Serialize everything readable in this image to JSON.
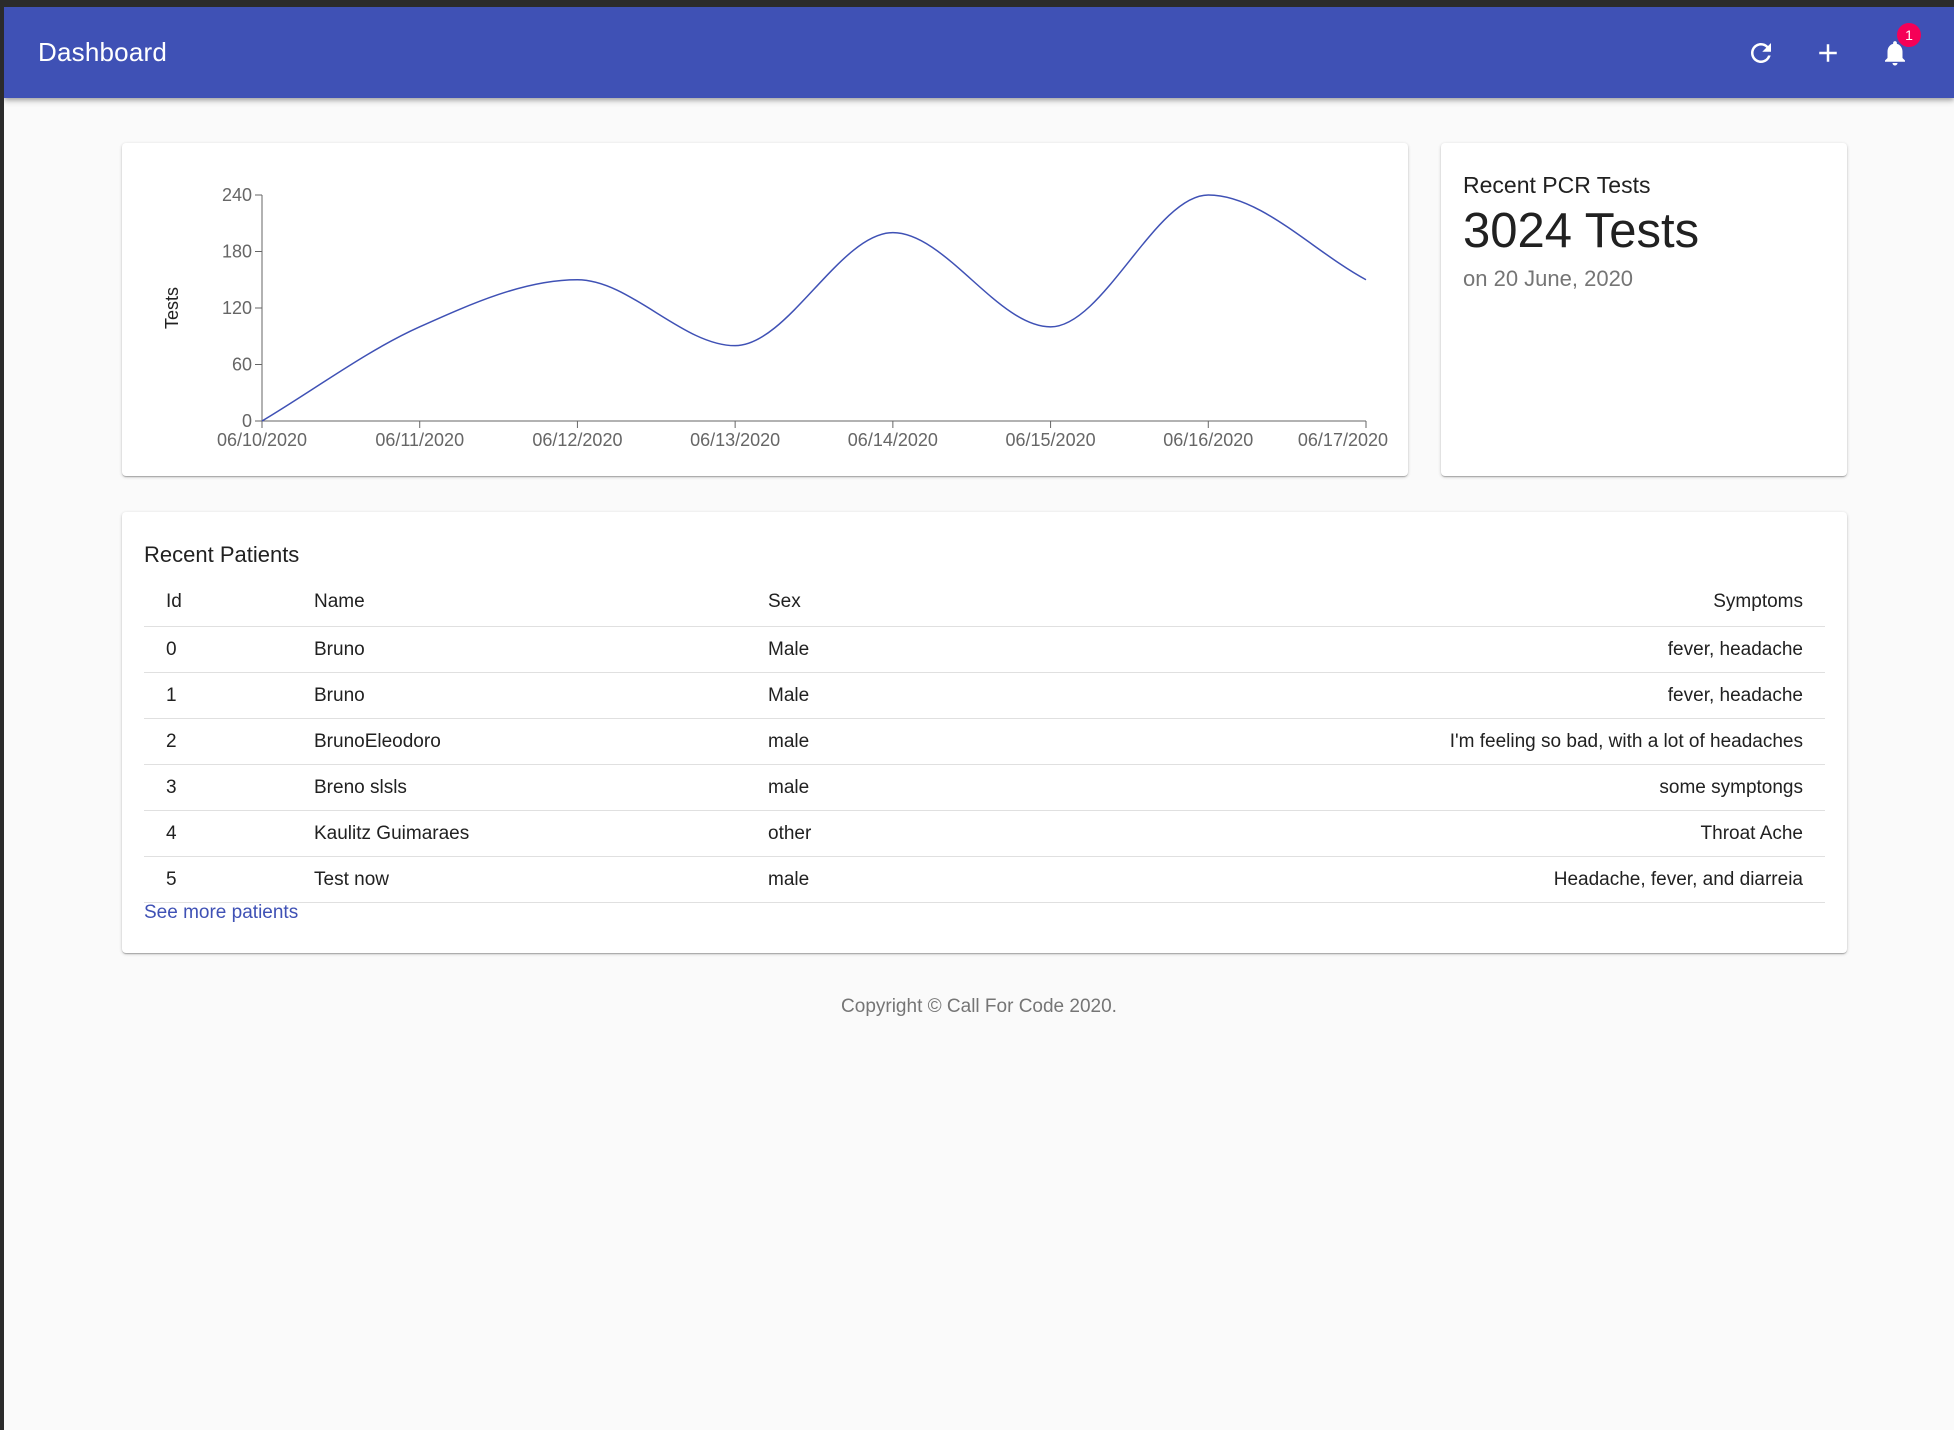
{
  "appbar": {
    "title": "Dashboard",
    "notification_count": "1",
    "color": "#3f51b5"
  },
  "actions": [
    {
      "icon": "refresh-icon"
    },
    {
      "icon": "add-icon"
    },
    {
      "icon": "bell-icon"
    }
  ],
  "chart_data": {
    "type": "line",
    "x": [
      "06/10/2020",
      "06/11/2020",
      "06/12/2020",
      "06/13/2020",
      "06/14/2020",
      "06/15/2020",
      "06/16/2020",
      "06/17/2020"
    ],
    "series": [
      {
        "values": [
          0,
          100,
          150,
          80,
          200,
          100,
          240,
          150
        ],
        "color": "#3f51b5"
      }
    ],
    "ylabel": "Tests",
    "yticks": [
      0,
      60,
      120,
      180,
      240
    ],
    "ylim": [
      0,
      240
    ],
    "curve": "smooth"
  },
  "pcr": {
    "title": "Recent PCR Tests",
    "value": "3024 Tests",
    "date": "on 20 June, 2020"
  },
  "patients": {
    "title": "Recent Patients",
    "columns": {
      "id": "Id",
      "name": "Name",
      "sex": "Sex",
      "symptoms": "Symptoms"
    },
    "rows": [
      {
        "id": "0",
        "name": "Bruno",
        "sex": "Male",
        "symptoms": "fever, headache"
      },
      {
        "id": "1",
        "name": "Bruno",
        "sex": "Male",
        "symptoms": "fever, headache"
      },
      {
        "id": "2",
        "name": "BrunoEleodoro",
        "sex": "male",
        "symptoms": "I'm feeling so bad, with a lot of headaches"
      },
      {
        "id": "3",
        "name": "Breno slsls",
        "sex": "male",
        "symptoms": "some symptongs"
      },
      {
        "id": "4",
        "name": "Kaulitz Guimaraes",
        "sex": "other",
        "symptoms": "Throat Ache"
      },
      {
        "id": "5",
        "name": "Test now",
        "sex": "male",
        "symptoms": "Headache, fever, and diarreia"
      }
    ],
    "see_more": "See more patients"
  },
  "footer": {
    "text": "Copyright © Call For Code 2020."
  }
}
